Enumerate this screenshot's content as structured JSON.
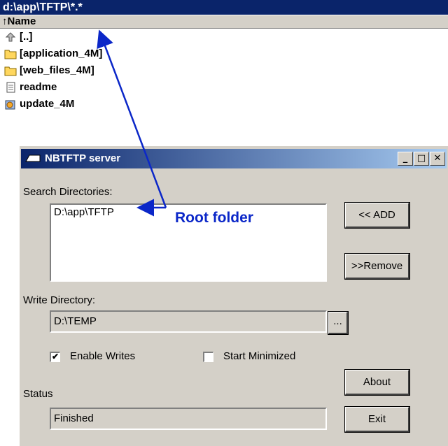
{
  "file_manager": {
    "path": "d:\\app\\TFTP\\*.*",
    "column_header": "↑Name",
    "rows": [
      {
        "label": "[..]",
        "icon": "parent-folder-icon"
      },
      {
        "label": "[application_4M]",
        "icon": "folder-icon"
      },
      {
        "label": "[web_files_4M]",
        "icon": "folder-icon"
      },
      {
        "label": "readme",
        "icon": "text-file-icon"
      },
      {
        "label": "update_4M",
        "icon": "executable-icon"
      }
    ]
  },
  "dialog": {
    "title": "NBTFTP server",
    "window_buttons": {
      "minimize": "_",
      "maximize": "□",
      "close": "✕"
    },
    "search_label": "Search Directories:",
    "search_dirs": [
      "D:\\app\\TFTP"
    ],
    "add_button": "<< ADD",
    "remove_button": ">>Remove",
    "write_label": "Write Directory:",
    "write_dir": "D:\\TEMP",
    "browse_button": "...",
    "enable_writes": {
      "label": "Enable Writes",
      "checked": true
    },
    "start_minimized": {
      "label": "Start Minimized",
      "checked": false
    },
    "about_button": "About",
    "status_label": "Status",
    "status_value": "Finished",
    "exit_button": "Exit"
  },
  "annotation": {
    "text": "Root folder",
    "color": "#0b27c8"
  }
}
